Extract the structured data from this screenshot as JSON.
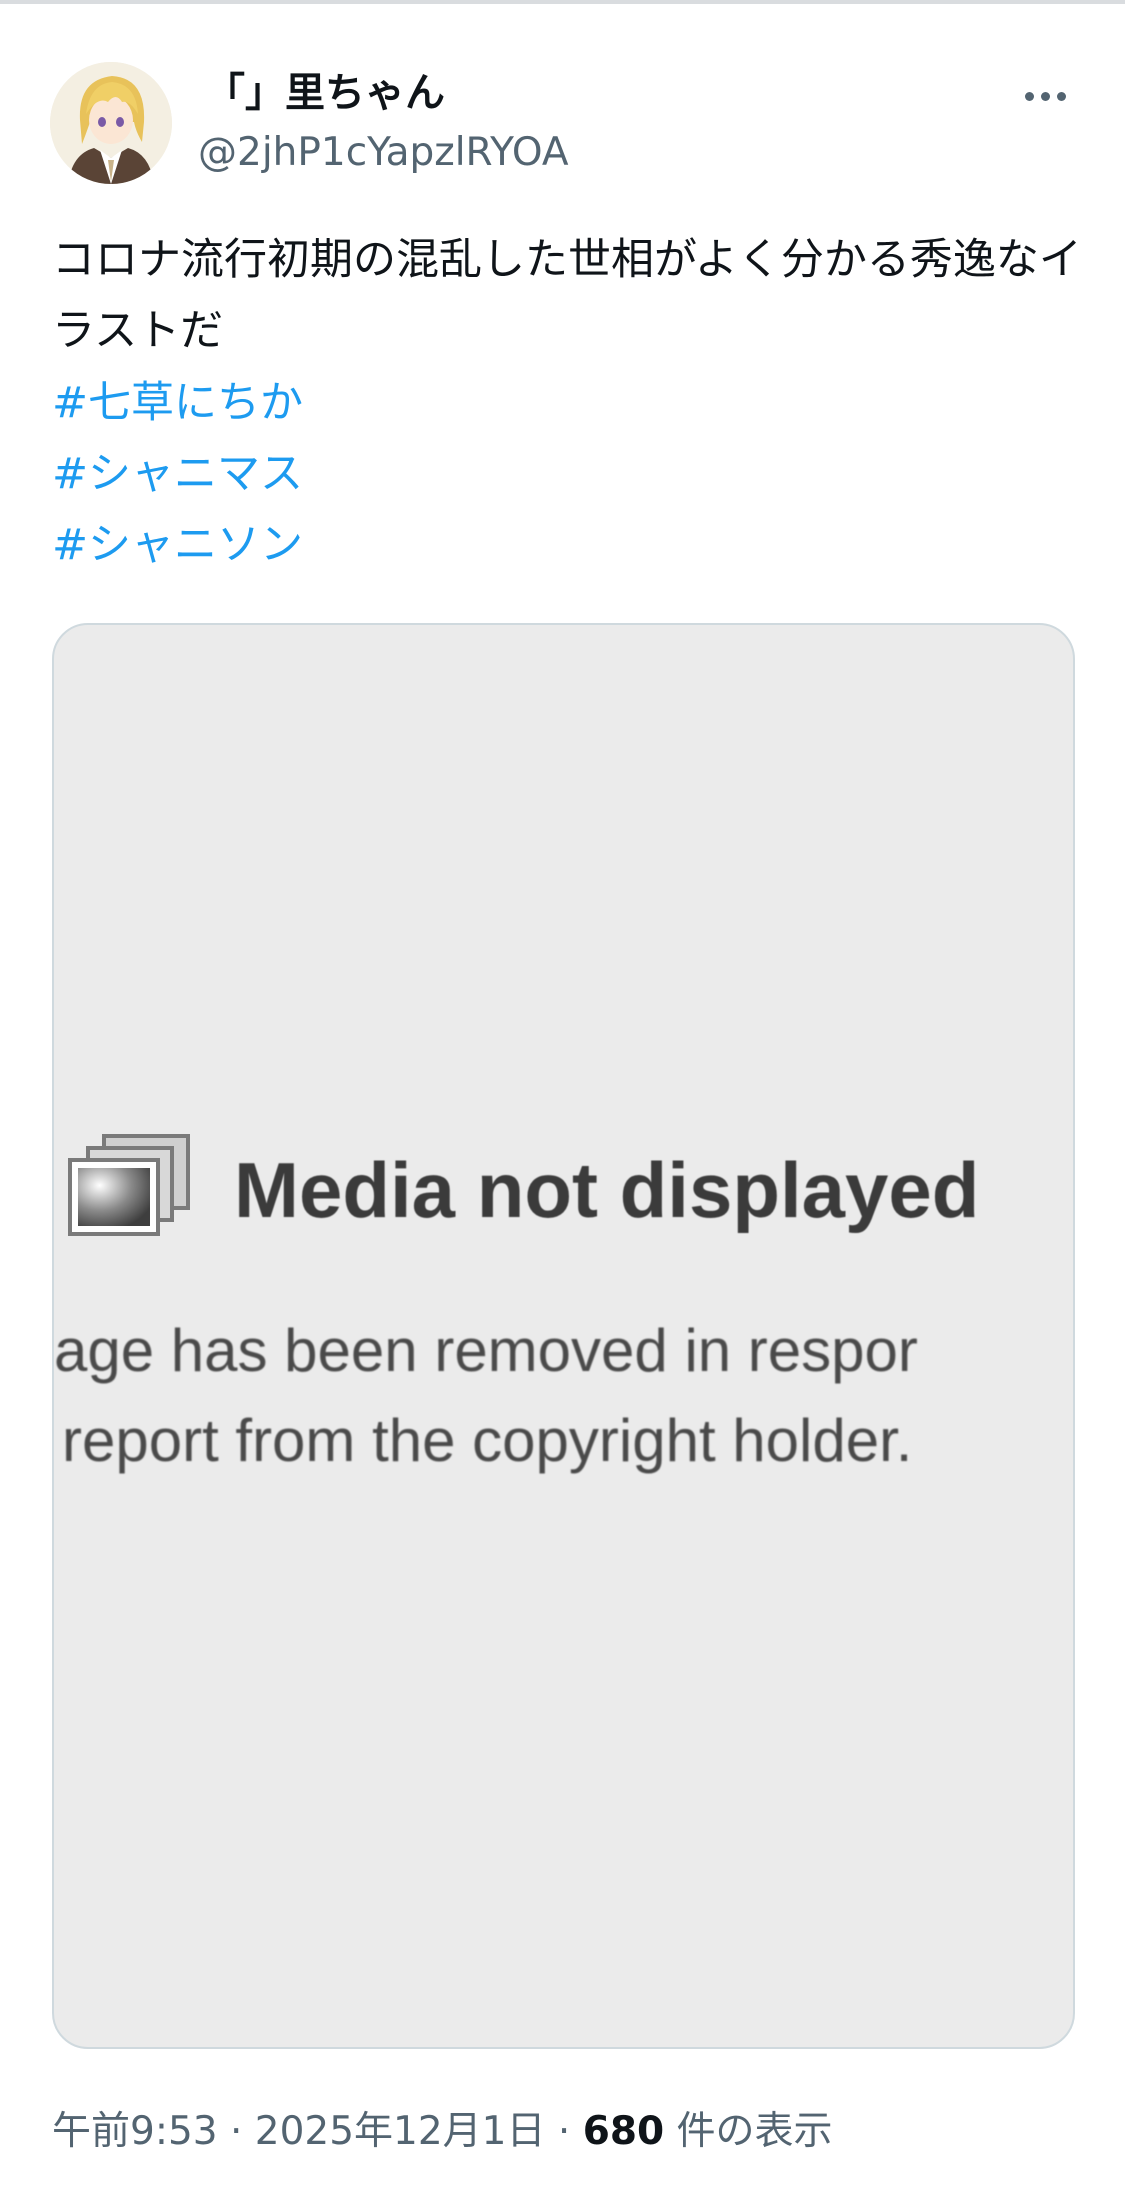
{
  "author": {
    "display_name": "「」里ちゃん",
    "handle": "@2jhP1cYapzlRYOA"
  },
  "more_icon": "more-horizontal-icon",
  "tweet": {
    "text": "コロナ流行初期の混乱した世相がよく分かる秀逸なイラストだ",
    "hashtags": [
      "#七草にちか",
      "#シャニマス",
      "#シャニソン"
    ]
  },
  "media": {
    "icon": "image-placeholder-icon",
    "title": "Media not displayed",
    "line1": "age has been removed in respor",
    "line2": "report from the copyright holder."
  },
  "meta": {
    "time": "午前9:53",
    "separator1": " · ",
    "date": "2025年12月1日",
    "separator2": " · ",
    "views_count": "680",
    "views_label": " 件の表示"
  },
  "colors": {
    "link": "#1d9bf0",
    "secondary_text": "#536471",
    "primary_text": "#0f1419",
    "media_bg": "#ebebeb",
    "border": "#cfd9de"
  }
}
